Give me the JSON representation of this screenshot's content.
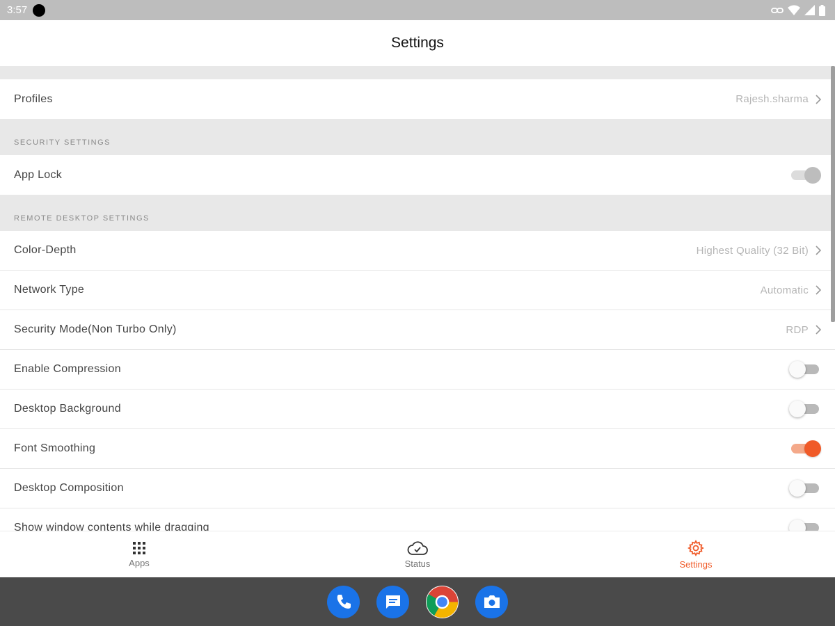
{
  "status_bar": {
    "time": "3:57",
    "icons": [
      "record-dot-icon",
      "link-icon",
      "wifi-icon",
      "signal-icon",
      "battery-icon"
    ]
  },
  "app_bar": {
    "title": "Settings"
  },
  "profiles": {
    "label": "Profiles",
    "value": "Rajesh.sharma"
  },
  "security_settings": {
    "header": "SECURITY SETTINGS",
    "app_lock": {
      "label": "App Lock",
      "state": "on-disabled"
    }
  },
  "remote_desktop_settings": {
    "header": "REMOTE DESKTOP SETTINGS",
    "color_depth": {
      "label": "Color-Depth",
      "value": "Highest Quality (32 Bit)"
    },
    "network_type": {
      "label": "Network Type",
      "value": "Automatic"
    },
    "security_mode": {
      "label": "Security Mode(Non Turbo Only)",
      "value": "RDP"
    },
    "enable_compression": {
      "label": "Enable Compression",
      "state": "off"
    },
    "desktop_background": {
      "label": "Desktop Background",
      "state": "off"
    },
    "font_smoothing": {
      "label": "Font Smoothing",
      "state": "on"
    },
    "desktop_composition": {
      "label": "Desktop Composition",
      "state": "off"
    },
    "show_window_contents": {
      "label": "Show window contents while dragging",
      "state": "off"
    }
  },
  "bottom_nav": {
    "apps": {
      "label": "Apps",
      "icon": "grid-icon"
    },
    "status": {
      "label": "Status",
      "icon": "cloud-check-icon"
    },
    "settings": {
      "label": "Settings",
      "icon": "gear-icon",
      "active": true
    }
  },
  "dock": {
    "apps": [
      "phone-icon",
      "messages-icon",
      "chrome-icon",
      "camera-icon"
    ]
  },
  "colors": {
    "accent": "#f05a28",
    "status_bar": "#bdbdbd",
    "section_bg": "#e8e8e8",
    "dock_bg": "#4a4a4a"
  }
}
